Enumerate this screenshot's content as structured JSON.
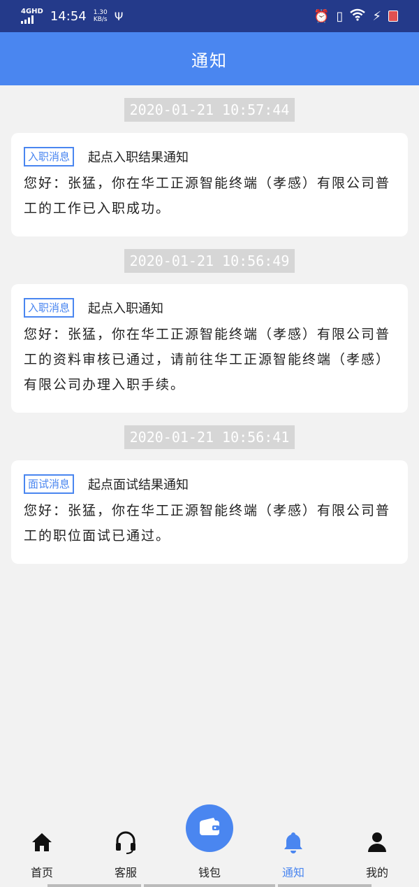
{
  "status_bar": {
    "network": "4GHD",
    "time": "14:54",
    "speed_value": "1.30",
    "speed_unit": "KB/s"
  },
  "header": {
    "title": "通知"
  },
  "notifications": [
    {
      "timestamp": "2020-01-21 10:57:44",
      "tag": "入职消息",
      "title": "起点入职结果通知",
      "body": "您好：张猛，你在华工正源智能终端（孝感）有限公司普工的工作已入职成功。"
    },
    {
      "timestamp": "2020-01-21 10:56:49",
      "tag": "入职消息",
      "title": "起点入职通知",
      "body": "您好：张猛，你在华工正源智能终端（孝感）有限公司普工的资料审核已通过，请前往华工正源智能终端（孝感）有限公司办理入职手续。"
    },
    {
      "timestamp": "2020-01-21 10:56:41",
      "tag": "面试消息",
      "title": "起点面试结果通知",
      "body": "您好：张猛，你在华工正源智能终端（孝感）有限公司普工的职位面试已通过。"
    }
  ],
  "nav": {
    "home": "首页",
    "service": "客服",
    "wallet": "钱包",
    "notice": "通知",
    "mine": "我的"
  },
  "colors": {
    "accent": "#4a86f0",
    "status_bar": "#243a8a"
  }
}
